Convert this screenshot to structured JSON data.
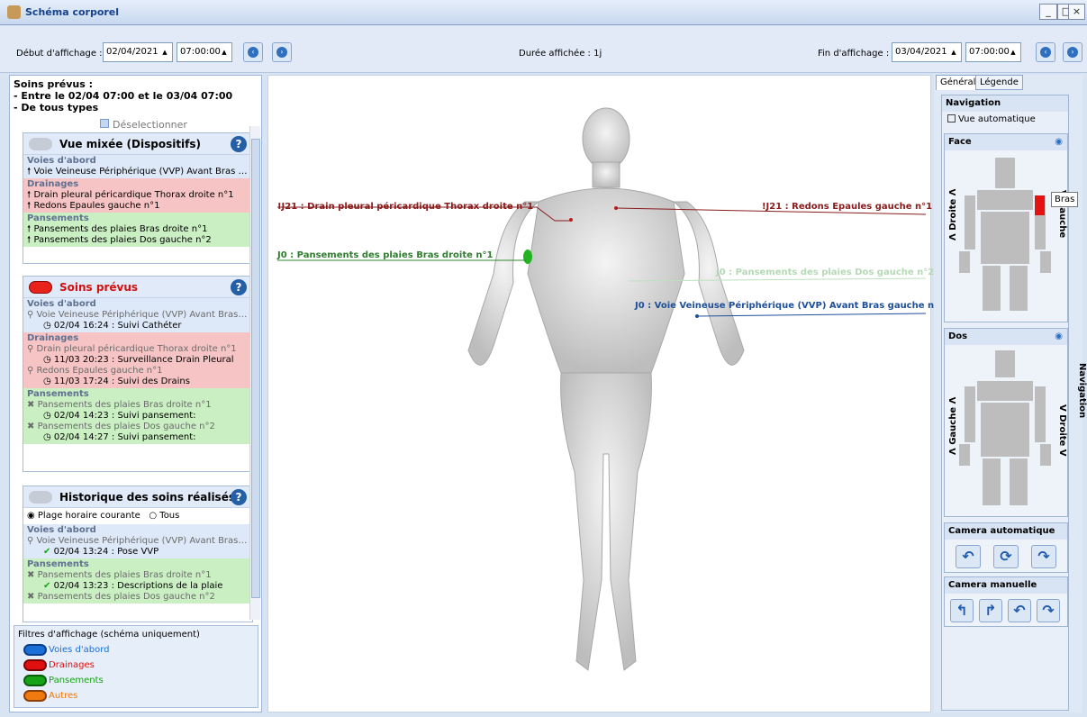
{
  "window": {
    "title": "Schéma corporel",
    "minimize": "_",
    "maximize": "□",
    "close": "×"
  },
  "toolbar": {
    "start_label": "Début d'affichage :",
    "start_date": "02/04/2021",
    "start_time": "07:00:00",
    "duration_label": "Durée affichée : 1j",
    "end_label": "Fin d'affichage :",
    "end_date": "03/04/2021",
    "end_time": "07:00:00"
  },
  "left": {
    "header_lines": [
      "Soins prévus :",
      "- Entre le 02/04 07:00 et le 03/04 07:00",
      "- De tous types"
    ],
    "deselect": "Déselectionner",
    "mixed": {
      "title": "Vue mixée (Dispositifs)",
      "voies_title": "Voies d'abord",
      "voies": [
        "Voie Veineuse Périphérique (VVP) Avant Bras ga..."
      ],
      "drain_title": "Drainages",
      "drainages": [
        "Drain pleural  péricardique  Thorax droite n°1",
        "Redons Epaules gauche n°1"
      ],
      "pans_title": "Pansements",
      "pansements": [
        "Pansements des plaies Bras droite n°1",
        "Pansements des plaies Dos gauche n°2"
      ]
    },
    "prevus": {
      "title": "Soins prévus",
      "voies_title": "Voies d'abord",
      "voie": "Voie Veineuse Périphérique (VVP) Avant Bras ga...",
      "voie_sub": "02/04 16:24 : Suivi Cathéter",
      "drain_title": "Drainages",
      "drain1": "Drain pleural  péricardique  Thorax droite n°1",
      "drain1_sub": "11/03 20:23 : Surveillance Drain Pleural",
      "drain2": "Redons Epaules gauche n°1",
      "drain2_sub": "11/03 17:24 : Suivi des Drains",
      "pans_title": "Pansements",
      "pans1": "Pansements des plaies Bras droite n°1",
      "pans1_sub": "02/04 14:23 : Suivi pansement:",
      "pans2": "Pansements des plaies Dos gauche n°2",
      "pans2_sub": "02/04 14:27 : Suivi pansement:"
    },
    "historique": {
      "title": "Historique des soins réalisés",
      "radio1": "Plage horaire courante",
      "radio2": "Tous",
      "voies_title": "Voies d'abord",
      "voie": "Voie Veineuse Périphérique (VVP) Avant Bras ga...",
      "voie_sub": "02/04 13:24 : Pose VVP",
      "pans_title": "Pansements",
      "pans1": "Pansements des plaies Bras droite n°1",
      "pans1_sub": "02/04 13:23 : Descriptions de la plaie",
      "pans2": "Pansements des plaies Dos gauche n°2"
    },
    "filters": {
      "title": "Filtres d'affichage (schéma uniquement)",
      "items": [
        {
          "label": "Voies d'abord",
          "color": "#1a6fd6"
        },
        {
          "label": "Drainages",
          "color": "#e01010"
        },
        {
          "label": "Pansements",
          "color": "#17a317"
        },
        {
          "label": "Autres",
          "color": "#f07a10"
        }
      ]
    }
  },
  "annotations": {
    "a1": "!J21 : Drain pleural  péricardique  Thorax droite n°1",
    "a2": "!J21 : Redons Epaules gauche n°1",
    "a3": "J0 : Pansements des plaies Bras droite n°1",
    "a4": "J0 : Pansements des plaies Dos gauche n°2",
    "a5": "J0 : Voie Veineuse Périphérique (VVP) Avant Bras gauche n°1"
  },
  "right": {
    "tab_general": "Général",
    "tab_legende": "Légende",
    "nav_title": "Navigation",
    "auto_view": "Vue automatique",
    "face": "Face",
    "dos": "Dos",
    "droite_up": "Λ Droite Λ",
    "gauche_down": "V Gauche",
    "gauche_up": "Λ Gauche Λ",
    "droite_down": "V Droite V",
    "tooltip": "Bras",
    "cam_auto": "Camera automatique",
    "cam_manual": "Camera manuelle",
    "side_label": "Navigation"
  }
}
